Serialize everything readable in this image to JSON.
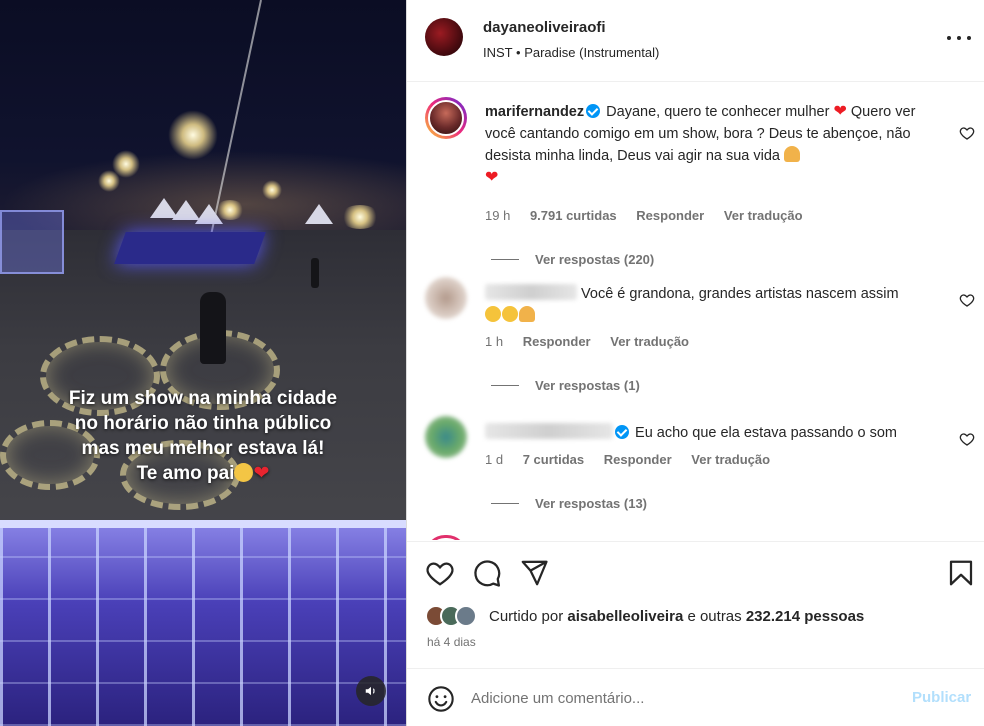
{
  "media": {
    "caption_lines": [
      "Fiz um show na minha cidade",
      "no horário não tinha público",
      "mas meu melhor estava lá!",
      "Te amo pai"
    ],
    "audio_icon": "speaker-icon"
  },
  "header": {
    "username": "dayaneoliveiraofi",
    "account_label": "INST",
    "separator": "•",
    "audio_title": "Paradise (Instrumental)",
    "more_icon": "more-options-icon"
  },
  "comments": [
    {
      "username": "marifernandez",
      "verified": true,
      "text_lines": [
        "Dayane, quero te conhecer mulher",
        "Quero",
        "ver você cantando comigo em um show, bora ? Deus te",
        "abençoe, não desista minha linda, Deus vai agir na sua vida"
      ],
      "time": "19 h",
      "likes": "9.791 curtidas",
      "reply_label": "Responder",
      "translate_label": "Ver tradução",
      "view_replies": "Ver respostas (220)"
    },
    {
      "username": "",
      "verified": false,
      "text": "Você é grandona, grandes artistas nascem assim",
      "time": "1 h",
      "reply_label": "Responder",
      "translate_label": "Ver tradução",
      "view_replies": "Ver respostas (1)"
    },
    {
      "username": "",
      "verified": true,
      "text": "Eu acho que ela estava passando o som",
      "time": "1 d",
      "likes": "7 curtidas",
      "reply_label": "Responder",
      "translate_label": "Ver tradução",
      "view_replies": "Ver respostas (13)"
    }
  ],
  "actions": {
    "icons": [
      "heart-icon",
      "comment-icon",
      "share-icon",
      "bookmark-icon"
    ],
    "liked_prefix": "Curtido por",
    "liked_user": "aisabelleoliveira",
    "liked_suffix": "e outras",
    "liked_count": "232.214",
    "liked_unit": "pessoas",
    "date": "há 4 dias"
  },
  "composer": {
    "placeholder": "Adicione um comentário...",
    "publish_label": "Publicar"
  },
  "colors": {
    "accent": "#0095f6",
    "publish_disabled": "#b2dffc",
    "text": "#262626",
    "muted": "#737373",
    "heart": "#ed1c24"
  }
}
